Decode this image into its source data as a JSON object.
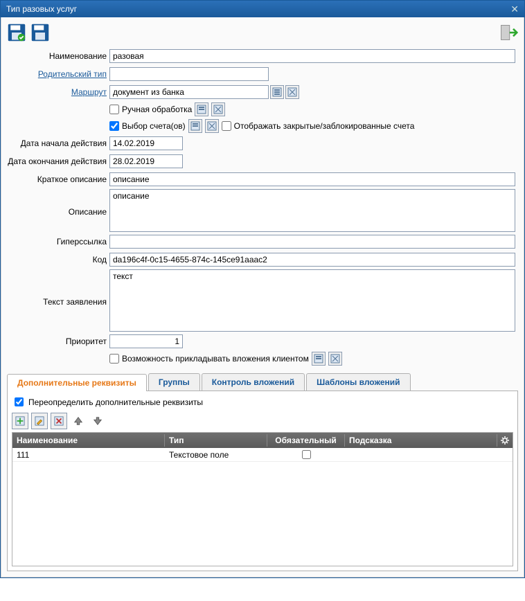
{
  "window": {
    "title": "Тип разовых услуг"
  },
  "labels": {
    "name": "Наименование",
    "parent_type": "Родительский тип",
    "route": "Маршрут",
    "manual": "Ручная обработка",
    "account_select": "Выбор счета(ов)",
    "show_closed": "Отображать закрытые/заблокированные счета",
    "date_start": "Дата начала действия",
    "date_end": "Дата окончания действия",
    "short_desc": "Краткое описание",
    "desc": "Описание",
    "hyperlink": "Гиперссылка",
    "code": "Код",
    "statement_text": "Текст заявления",
    "priority": "Приоритет",
    "attach_ability": "Возможность прикладывать вложения клиентом"
  },
  "fields": {
    "name": "разовая",
    "parent_type": "",
    "route": "документ из банка",
    "manual": false,
    "account_select": true,
    "show_closed": false,
    "date_start": "14.02.2019",
    "date_end": "28.02.2019",
    "short_desc": "описание",
    "desc": "описание",
    "hyperlink": "",
    "code": "da196c4f-0c15-4655-874c-145ce91aaac2",
    "statement_text": "текст",
    "priority": "1",
    "attach_ability": false
  },
  "tabs": {
    "t1": "Дополнительные реквизиты",
    "t2": "Группы",
    "t3": "Контроль вложений",
    "t4": "Шаблоны вложений"
  },
  "panel": {
    "override": "Переопределить дополнительные реквизиты",
    "override_checked": true,
    "headers": {
      "name": "Наименование",
      "type": "Тип",
      "required": "Обязательный",
      "hint": "Подсказка"
    },
    "rows": [
      {
        "name": "111",
        "type": "Текстовое поле",
        "required": false,
        "hint": ""
      }
    ]
  }
}
